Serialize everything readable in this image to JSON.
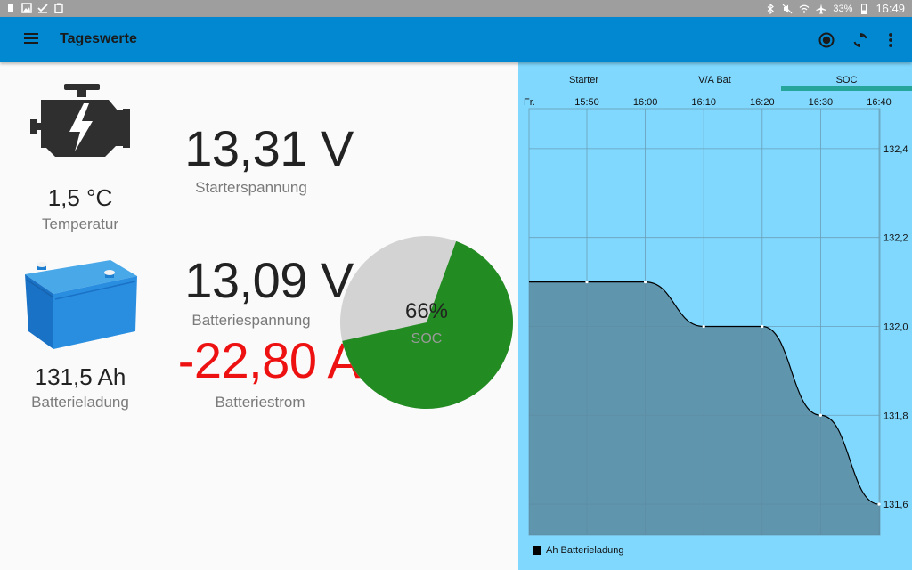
{
  "status_bar": {
    "battery_pct": "33%",
    "time": "16:49",
    "left_icons": [
      "battery-saver-icon",
      "image-icon",
      "check-icon",
      "clipboard-icon"
    ],
    "right_icons": [
      "bluetooth-icon",
      "mute-icon",
      "wifi-icon",
      "airplane-icon",
      "battery-icon"
    ]
  },
  "appbar": {
    "title": "Tageswerte",
    "actions": [
      "record-icon",
      "refresh-icon",
      "more-vert-icon"
    ],
    "color": "#0288d1"
  },
  "dashboard": {
    "temperature": {
      "value": "1,5 °C",
      "label": "Temperatur"
    },
    "starter_voltage": {
      "value": "13,31 V",
      "label": "Starterspannung"
    },
    "battery_voltage": {
      "value": "13,09 V",
      "label": "Batteriespannung"
    },
    "battery_current": {
      "value": "-22,80 A",
      "label": "Batteriestrom",
      "color": "#ee1111"
    },
    "battery_charge": {
      "value": "131,5 Ah",
      "label": "Batterieladung"
    },
    "soc": {
      "value": "66%",
      "label": "SOC",
      "fraction": 0.66,
      "fill_color": "#228b22",
      "rest_color": "#d3d3d3"
    }
  },
  "chart_panel": {
    "tabs": [
      "Starter",
      "V/A Bat",
      "SOC"
    ],
    "selected_tab": 2,
    "background": "#80d8ff",
    "tab_indicator_color": "#26a69a"
  },
  "chart_data": {
    "type": "area",
    "day_label": "Fr.",
    "x_tick_labels": [
      "15:50",
      "16:00",
      "16:10",
      "16:20",
      "16:30",
      "16:40"
    ],
    "y_tick_labels": [
      "132,4",
      "132,2",
      "132,0",
      "131,8",
      "131,6"
    ],
    "ylim": [
      131.53,
      132.49
    ],
    "series": [
      {
        "name": "Ah Batterieladung",
        "color": "#000000",
        "fill": "#5a8aa0",
        "x": [
          "15:40",
          "15:50",
          "16:00",
          "16:10",
          "16:20",
          "16:30",
          "16:40"
        ],
        "values": [
          132.1,
          132.1,
          132.1,
          132.0,
          132.0,
          131.8,
          131.6
        ]
      }
    ],
    "legend_position": "bottom-left",
    "grid": true
  }
}
